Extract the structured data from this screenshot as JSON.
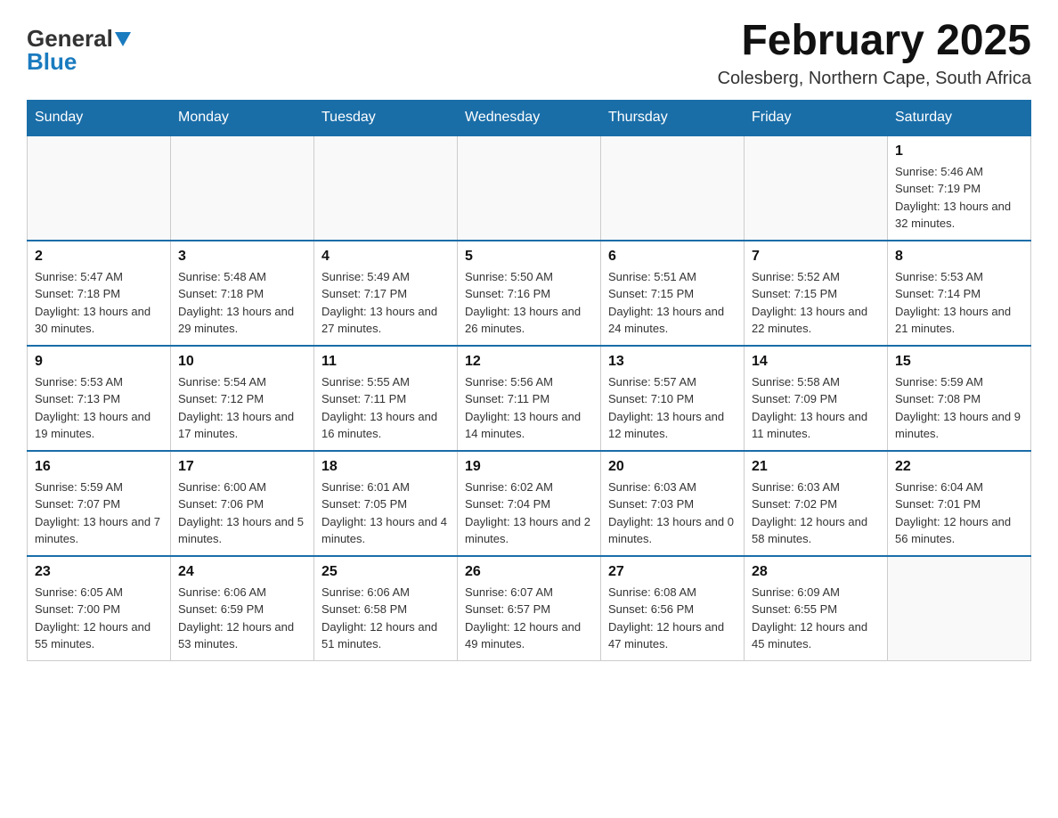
{
  "header": {
    "logo": {
      "general": "General",
      "blue": "Blue"
    },
    "title": "February 2025",
    "location": "Colesberg, Northern Cape, South Africa"
  },
  "weekdays": [
    "Sunday",
    "Monday",
    "Tuesday",
    "Wednesday",
    "Thursday",
    "Friday",
    "Saturday"
  ],
  "weeks": [
    [
      {
        "day": "",
        "info": ""
      },
      {
        "day": "",
        "info": ""
      },
      {
        "day": "",
        "info": ""
      },
      {
        "day": "",
        "info": ""
      },
      {
        "day": "",
        "info": ""
      },
      {
        "day": "",
        "info": ""
      },
      {
        "day": "1",
        "info": "Sunrise: 5:46 AM\nSunset: 7:19 PM\nDaylight: 13 hours and 32 minutes."
      }
    ],
    [
      {
        "day": "2",
        "info": "Sunrise: 5:47 AM\nSunset: 7:18 PM\nDaylight: 13 hours and 30 minutes."
      },
      {
        "day": "3",
        "info": "Sunrise: 5:48 AM\nSunset: 7:18 PM\nDaylight: 13 hours and 29 minutes."
      },
      {
        "day": "4",
        "info": "Sunrise: 5:49 AM\nSunset: 7:17 PM\nDaylight: 13 hours and 27 minutes."
      },
      {
        "day": "5",
        "info": "Sunrise: 5:50 AM\nSunset: 7:16 PM\nDaylight: 13 hours and 26 minutes."
      },
      {
        "day": "6",
        "info": "Sunrise: 5:51 AM\nSunset: 7:15 PM\nDaylight: 13 hours and 24 minutes."
      },
      {
        "day": "7",
        "info": "Sunrise: 5:52 AM\nSunset: 7:15 PM\nDaylight: 13 hours and 22 minutes."
      },
      {
        "day": "8",
        "info": "Sunrise: 5:53 AM\nSunset: 7:14 PM\nDaylight: 13 hours and 21 minutes."
      }
    ],
    [
      {
        "day": "9",
        "info": "Sunrise: 5:53 AM\nSunset: 7:13 PM\nDaylight: 13 hours and 19 minutes."
      },
      {
        "day": "10",
        "info": "Sunrise: 5:54 AM\nSunset: 7:12 PM\nDaylight: 13 hours and 17 minutes."
      },
      {
        "day": "11",
        "info": "Sunrise: 5:55 AM\nSunset: 7:11 PM\nDaylight: 13 hours and 16 minutes."
      },
      {
        "day": "12",
        "info": "Sunrise: 5:56 AM\nSunset: 7:11 PM\nDaylight: 13 hours and 14 minutes."
      },
      {
        "day": "13",
        "info": "Sunrise: 5:57 AM\nSunset: 7:10 PM\nDaylight: 13 hours and 12 minutes."
      },
      {
        "day": "14",
        "info": "Sunrise: 5:58 AM\nSunset: 7:09 PM\nDaylight: 13 hours and 11 minutes."
      },
      {
        "day": "15",
        "info": "Sunrise: 5:59 AM\nSunset: 7:08 PM\nDaylight: 13 hours and 9 minutes."
      }
    ],
    [
      {
        "day": "16",
        "info": "Sunrise: 5:59 AM\nSunset: 7:07 PM\nDaylight: 13 hours and 7 minutes."
      },
      {
        "day": "17",
        "info": "Sunrise: 6:00 AM\nSunset: 7:06 PM\nDaylight: 13 hours and 5 minutes."
      },
      {
        "day": "18",
        "info": "Sunrise: 6:01 AM\nSunset: 7:05 PM\nDaylight: 13 hours and 4 minutes."
      },
      {
        "day": "19",
        "info": "Sunrise: 6:02 AM\nSunset: 7:04 PM\nDaylight: 13 hours and 2 minutes."
      },
      {
        "day": "20",
        "info": "Sunrise: 6:03 AM\nSunset: 7:03 PM\nDaylight: 13 hours and 0 minutes."
      },
      {
        "day": "21",
        "info": "Sunrise: 6:03 AM\nSunset: 7:02 PM\nDaylight: 12 hours and 58 minutes."
      },
      {
        "day": "22",
        "info": "Sunrise: 6:04 AM\nSunset: 7:01 PM\nDaylight: 12 hours and 56 minutes."
      }
    ],
    [
      {
        "day": "23",
        "info": "Sunrise: 6:05 AM\nSunset: 7:00 PM\nDaylight: 12 hours and 55 minutes."
      },
      {
        "day": "24",
        "info": "Sunrise: 6:06 AM\nSunset: 6:59 PM\nDaylight: 12 hours and 53 minutes."
      },
      {
        "day": "25",
        "info": "Sunrise: 6:06 AM\nSunset: 6:58 PM\nDaylight: 12 hours and 51 minutes."
      },
      {
        "day": "26",
        "info": "Sunrise: 6:07 AM\nSunset: 6:57 PM\nDaylight: 12 hours and 49 minutes."
      },
      {
        "day": "27",
        "info": "Sunrise: 6:08 AM\nSunset: 6:56 PM\nDaylight: 12 hours and 47 minutes."
      },
      {
        "day": "28",
        "info": "Sunrise: 6:09 AM\nSunset: 6:55 PM\nDaylight: 12 hours and 45 minutes."
      },
      {
        "day": "",
        "info": ""
      }
    ]
  ]
}
